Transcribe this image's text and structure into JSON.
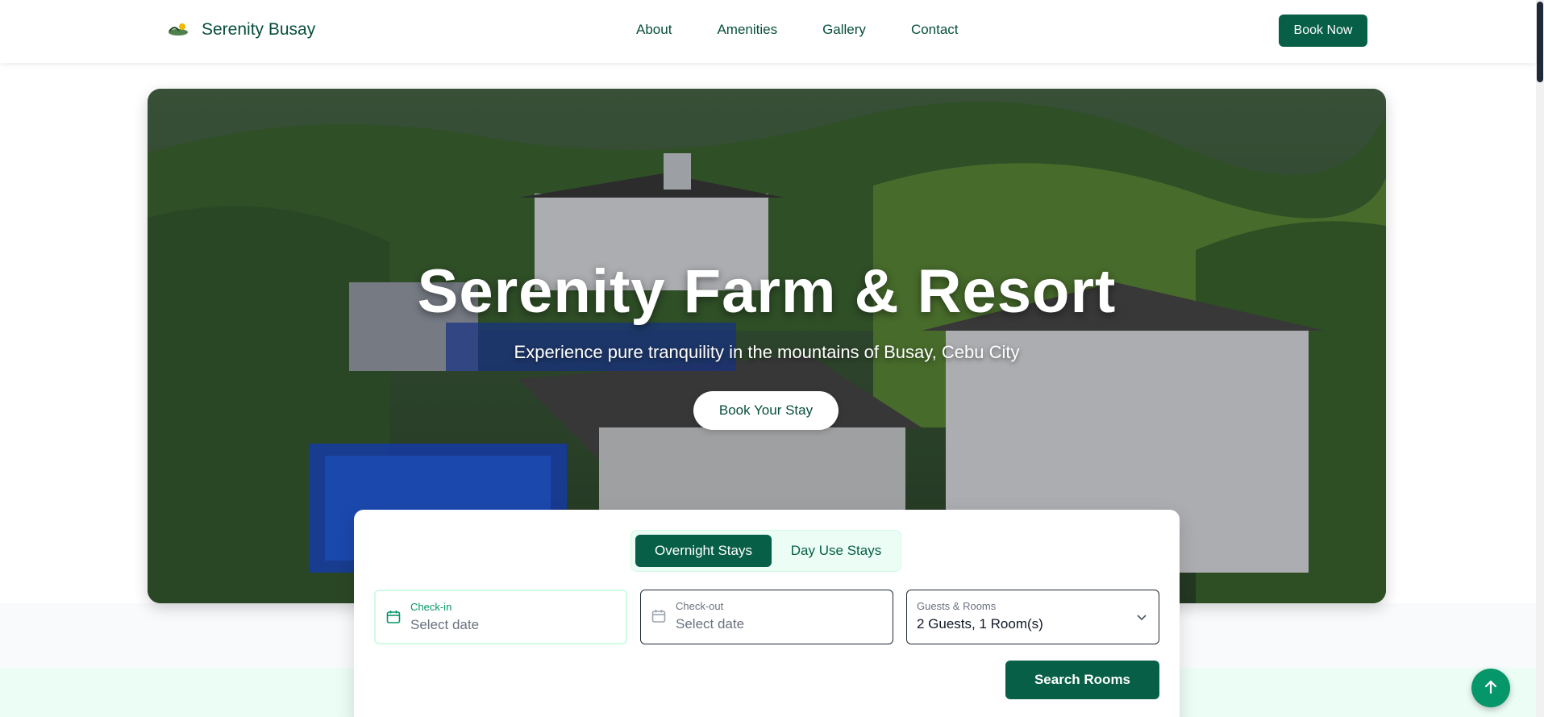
{
  "header": {
    "logo_icon": "serenity-logo-icon",
    "brand": "Serenity Busay",
    "nav": [
      {
        "label": "About"
      },
      {
        "label": "Amenities"
      },
      {
        "label": "Gallery"
      },
      {
        "label": "Contact"
      }
    ],
    "book_now": "Book Now"
  },
  "hero": {
    "title": "Serenity Farm & Resort",
    "subtitle": "Experience pure tranquility in the mountains of Busay, Cebu City",
    "cta": "Book Your Stay"
  },
  "booking": {
    "tabs": [
      {
        "label": "Overnight Stays",
        "active": true
      },
      {
        "label": "Day Use Stays",
        "active": false
      }
    ],
    "check_in": {
      "label": "Check-in",
      "placeholder": "Select date",
      "icon": "calendar-icon"
    },
    "check_out": {
      "label": "Check-out",
      "placeholder": "Select date",
      "icon": "calendar-icon"
    },
    "guests": {
      "label": "Guests & Rooms",
      "value": "2 Guests, 1 Room(s)",
      "icon": "chevron-down-icon"
    },
    "search": "Search Rooms"
  },
  "back_to_top": {
    "icon": "arrow-up-icon"
  },
  "colors": {
    "primary": "#065f46",
    "accent": "#059669",
    "mint": "#ecfdf5",
    "text": "#064e3b"
  }
}
